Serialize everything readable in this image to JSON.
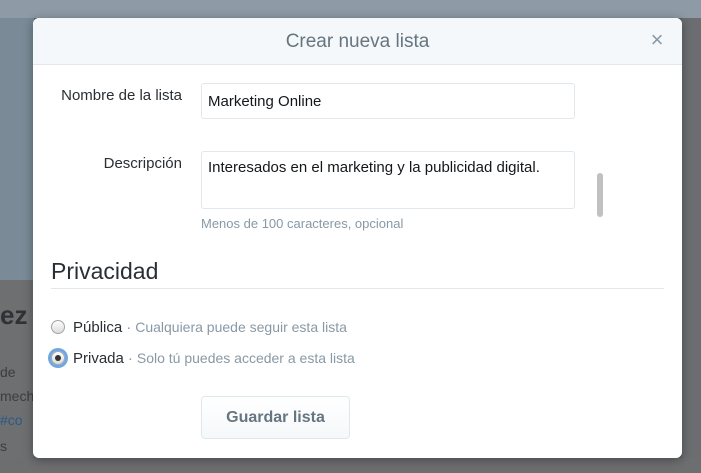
{
  "background": {
    "frag_ez": "ez",
    "frag_de": "de",
    "frag_mech": "mech",
    "frag_hash": "#co",
    "frag_s": "s"
  },
  "dialog": {
    "title": "Crear nueva lista",
    "close_label": "×",
    "name_label": "Nombre de la lista",
    "name_value": "Marketing Online",
    "description_label": "Descripción",
    "description_value": "Interesados en el marketing y la publicidad digital.",
    "description_hint": "Menos de 100 caracteres, opcional",
    "privacy_title": "Privacidad",
    "options": [
      {
        "name": "Pública",
        "separator": "·",
        "description": "Cualquiera puede seguir esta lista",
        "checked": false
      },
      {
        "name": "Privada",
        "separator": "·",
        "description": "Solo tú puedes acceder a esta lista",
        "checked": true
      }
    ],
    "save_label": "Guardar lista"
  },
  "colors": {
    "accent_focus": "#6fa7e3",
    "muted_text": "#8899a6",
    "title_text": "#66757f"
  }
}
